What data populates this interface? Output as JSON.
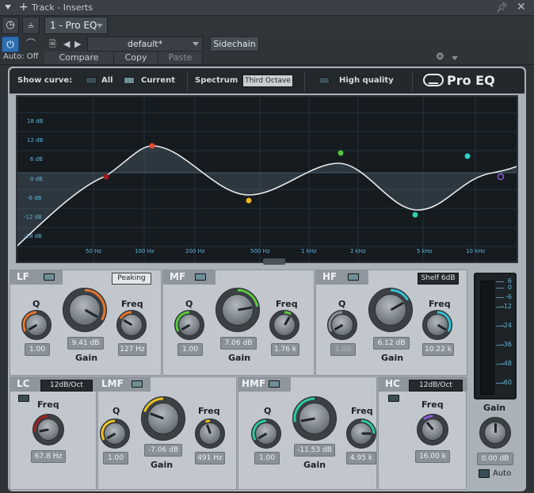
{
  "window": {
    "title": "Track - Inserts"
  },
  "preset_tab": "1 - Pro EQ",
  "controls": {
    "auto_label": "Auto: Off",
    "preset_name": "default*",
    "sidechain": "Sidechain",
    "compare": "Compare",
    "copy": "Copy",
    "paste": "Paste"
  },
  "header": {
    "show_curve": "Show curve:",
    "all": "All",
    "current": "Current",
    "spectrum": "Spectrum",
    "spectrum_mode": "Third Octave",
    "high_quality": "High quality",
    "logo": "Pro EQ"
  },
  "graph": {
    "db_labels": [
      "18 dB",
      "12 dB",
      "6 dB",
      "0 dB",
      "-6 dB",
      "-12 dB",
      "-18 dB"
    ],
    "freq_labels": [
      "50 Hz",
      "100 Hz",
      "200 Hz",
      "500 Hz",
      "1 kHz",
      "2 kHz",
      "5 kHz",
      "10 kHz"
    ],
    "node_colors": [
      "#e84b2a",
      "#f0b51e",
      "#52c63a",
      "#2bd1a8",
      "#2bd1c6",
      "#8b5bd6",
      "#a01818"
    ]
  },
  "bands": {
    "lf": {
      "name": "LF",
      "type": "Peaking",
      "q_label": "Q",
      "freq_label": "Freq",
      "gain_label": "Gain",
      "q": "1.00",
      "gain": "9.41 dB",
      "freq": "127 Hz",
      "color": "#e8742a"
    },
    "mf": {
      "name": "MF",
      "q_label": "Q",
      "freq_label": "Freq",
      "gain_label": "Gain",
      "q": "1.00",
      "gain": "7.06 dB",
      "freq": "1.76 k",
      "color": "#5ac93c"
    },
    "hf": {
      "name": "HF",
      "type": "Shelf 6dB",
      "q_label": "Q",
      "freq_label": "Freq",
      "gain_label": "Gain",
      "q": "1.00",
      "gain": "6.12 dB",
      "freq": "10.22 k",
      "color": "#36c2d4"
    },
    "lc": {
      "name": "LC",
      "type": "12dB/Oct",
      "freq_label": "Freq",
      "freq": "67.8 Hz",
      "color": "#a02020"
    },
    "lmf": {
      "name": "LMF",
      "q_label": "Q",
      "freq_label": "Freq",
      "gain_label": "Gain",
      "q": "1.00",
      "gain": "-7.06 dB",
      "freq": "491 Hz",
      "color": "#e9c220"
    },
    "hmf": {
      "name": "HMF",
      "q_label": "Q",
      "freq_label": "Freq",
      "gain_label": "Gain",
      "q": "1.00",
      "gain": "-11.53 dB",
      "freq": "4.95 k",
      "color": "#2dcaa0"
    },
    "hc": {
      "name": "HC",
      "type": "12dB/Oct",
      "freq_label": "Freq",
      "freq": "16.00 k",
      "color": "#8b5bd6"
    }
  },
  "output": {
    "gain_label": "Gain",
    "gain": "0.00 dB",
    "auto": "Auto",
    "meter_ticks": [
      "6",
      "0",
      "-6",
      "-12",
      "-24",
      "-36",
      "-48",
      "-60"
    ]
  }
}
